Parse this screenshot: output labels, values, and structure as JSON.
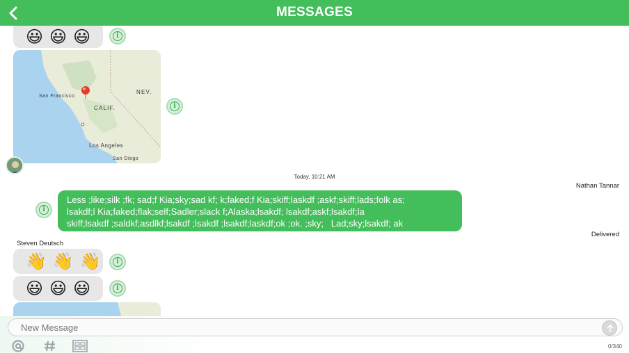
{
  "header": {
    "title": "MESSAGES"
  },
  "icons": {
    "back": "chevron-left-icon",
    "info": "info-icon",
    "send": "send-arrow-icon",
    "mention": "at-sign-icon",
    "hashtag": "hashtag-icon",
    "template": "template-icon"
  },
  "messages": {
    "top_emojis": [
      "😃",
      "😃",
      "😃"
    ],
    "map": {
      "labels": {
        "sf": "San Francisco",
        "calif": "CALIF.",
        "nev": "NEV.",
        "la": "Los Angeles",
        "sd": "San Diego"
      }
    },
    "timestamp": "Today, 10:21 AM",
    "outgoing_sender": "Nathan Tannar",
    "outgoing_text": "Less ;like;silk ;fk; sad;f Kia;sky;sad kf; k;faked;f Kia;skiff;laskdf ;askf;skiff;lads;folk as;\nlsakdf;l Kia;faked;flak;self;Sadler;slack f;Alaska;lsakdf; lsakdf;askf;lsakdf;la\nskiff;lsakdf ;saldkf;asdlkf;lsakdf ;lsakdf ;lsakdf;laskdf;ok ;ok. ;sky;   Lad;sky;lsakdf; ak",
    "delivered": "Delivered",
    "incoming_sender": "Steven Deutsch",
    "wave_emojis": [
      "👋",
      "👋",
      "👋"
    ],
    "bottom_emojis": [
      "😃",
      "😃",
      "😃"
    ]
  },
  "composer": {
    "placeholder": "New Message",
    "counter": "0/340"
  },
  "colors": {
    "accent": "#43be5b",
    "bubble_gray": "#e7e7e7"
  }
}
